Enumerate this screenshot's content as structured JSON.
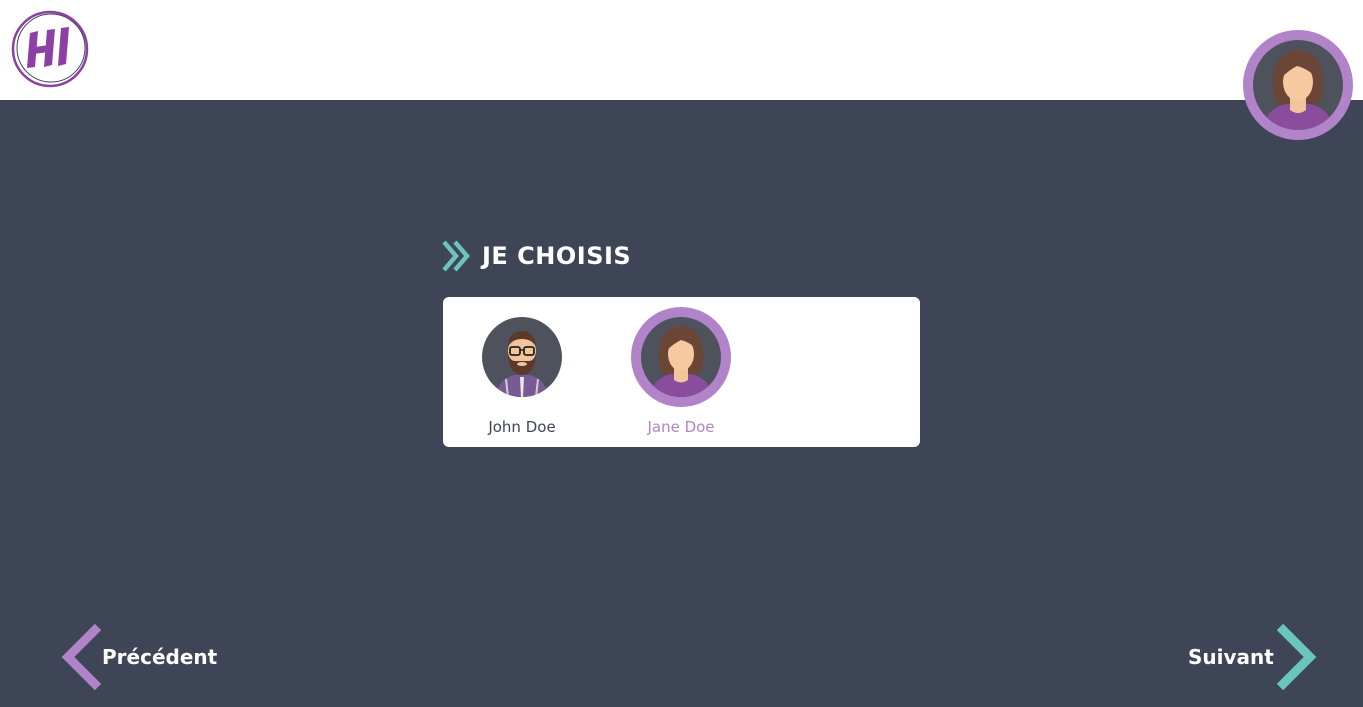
{
  "header": {
    "logo_text": "HI"
  },
  "main": {
    "title": "JE CHOISIS",
    "people": [
      {
        "name": "John Doe",
        "selected": false
      },
      {
        "name": "Jane Doe",
        "selected": true
      }
    ]
  },
  "navigation": {
    "prev_label": "Précédent",
    "next_label": "Suivant"
  },
  "colors": {
    "background": "#3e4557",
    "accent_purple": "#b184c9",
    "accent_teal": "#6ac6bc"
  }
}
